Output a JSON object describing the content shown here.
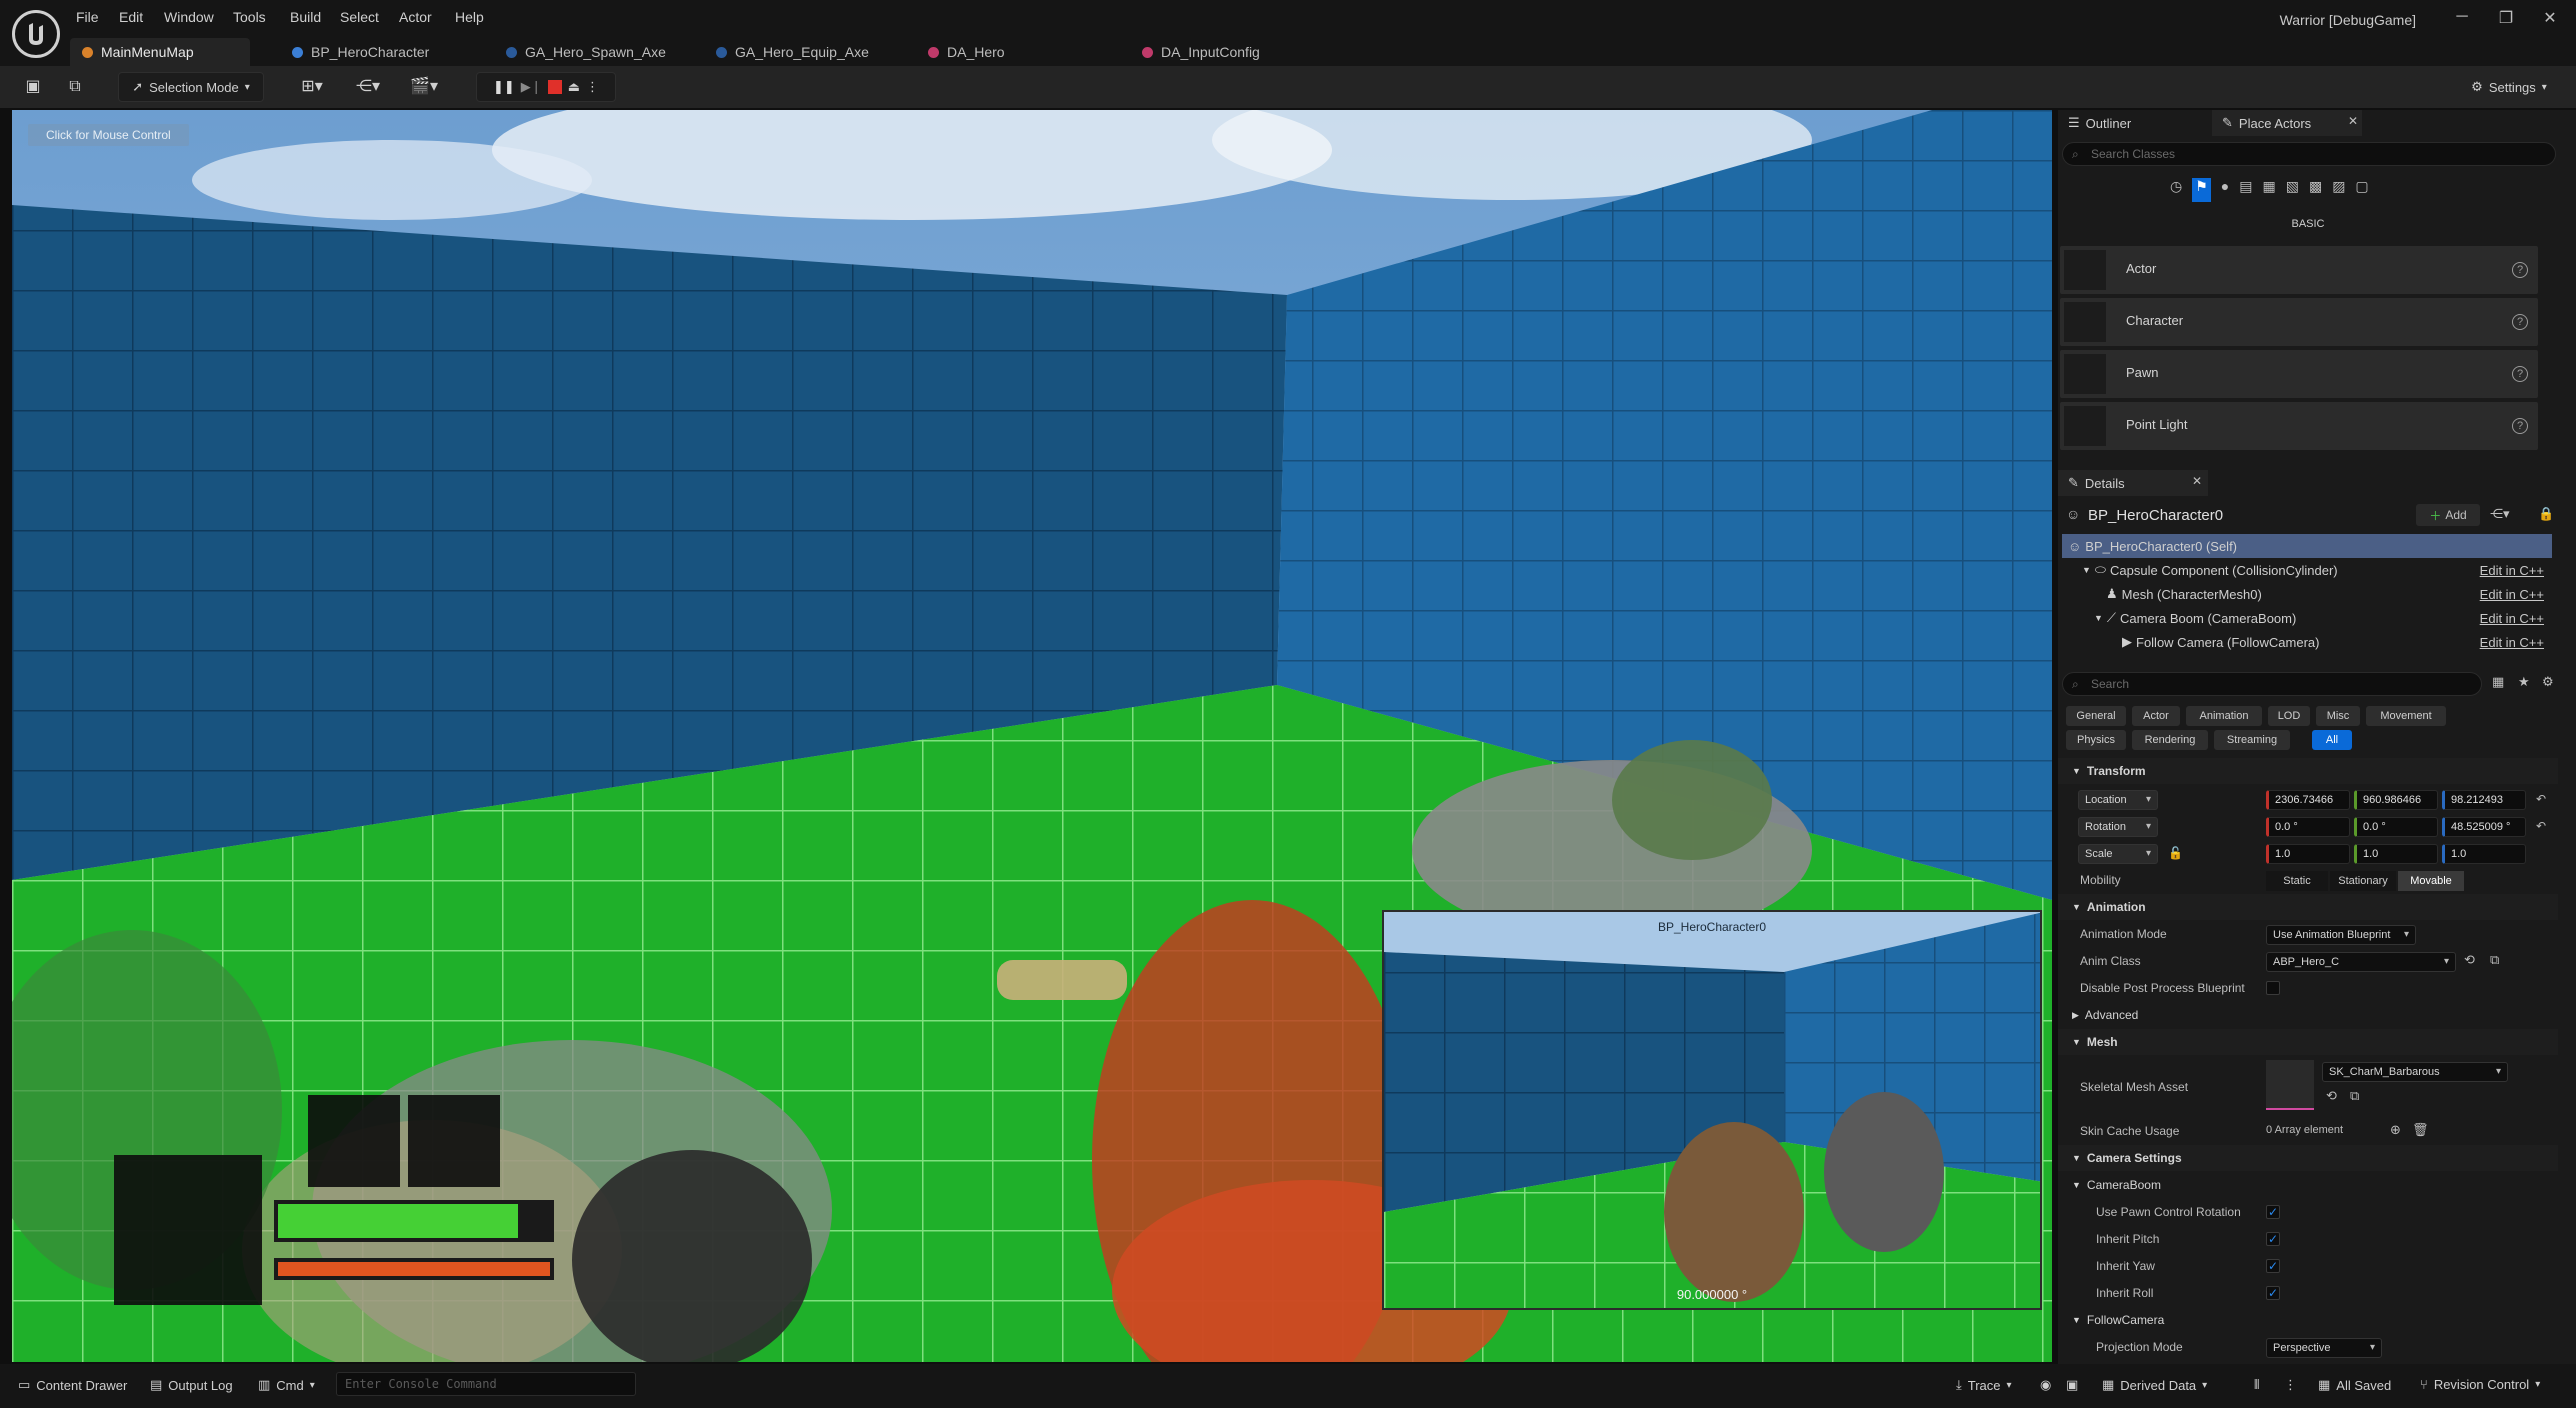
{
  "menu": {
    "items": [
      "File",
      "Edit",
      "Window",
      "Tools",
      "Build",
      "Select",
      "Actor",
      "Help"
    ]
  },
  "window": {
    "title": "Warrior [DebugGame]",
    "minimize": "─",
    "restore": "❐",
    "close": "✕"
  },
  "tabs": [
    {
      "label": "MainMenuMap",
      "color": "#d9822b"
    },
    {
      "label": "BP_HeroCharacter",
      "color": "#3b7fd6"
    },
    {
      "label": "GA_Hero_Spawn_Axe",
      "color": "#3b7fd6"
    },
    {
      "label": "GA_Hero_Equip_Axe",
      "color": "#3b7fd6"
    },
    {
      "label": "DA_Hero",
      "color": "#c03a6a"
    },
    {
      "label": "DA_InputConfig",
      "color": "#c03a6a"
    }
  ],
  "toolbar": {
    "selection_mode": "Selection Mode",
    "settings": "Settings"
  },
  "viewport": {
    "click_hint": "Click for Mouse Control",
    "pip_title": "BP_HeroCharacter0",
    "pip_fov": "90.000000 °"
  },
  "outliner": {
    "tab_outliner": "Outliner",
    "tab_place_actors": "Place Actors",
    "search_placeholder": "Search Classes",
    "category": "BASIC",
    "actors": [
      "Actor",
      "Character",
      "Pawn",
      "Point Light"
    ],
    "help": "?"
  },
  "details": {
    "tab_label": "Details",
    "object_name": "BP_HeroCharacter0",
    "add_label": "Add",
    "components": [
      {
        "label": "BP_HeroCharacter0 (Self)",
        "link": ""
      },
      {
        "label": "Capsule Component (CollisionCylinder)",
        "link": "Edit in C++"
      },
      {
        "label": "Mesh (CharacterMesh0)",
        "link": "Edit in C++"
      },
      {
        "label": "Camera Boom (CameraBoom)",
        "link": "Edit in C++"
      },
      {
        "label": "Follow Camera (FollowCamera)",
        "link": "Edit in C++"
      }
    ],
    "search_placeholder": "Search",
    "filters_row1": [
      "General",
      "Actor",
      "Animation",
      "LOD",
      "Misc",
      "Movement"
    ],
    "filters_row2": [
      "Physics",
      "Rendering",
      "Streaming",
      "All"
    ],
    "active_filter": "All",
    "transform": {
      "header": "Transform",
      "location_label": "Location",
      "location": [
        "2306.73466",
        "960.986466",
        "98.212493"
      ],
      "rotation_label": "Rotation",
      "rotation": [
        "0.0 °",
        "0.0 °",
        "48.525009 °"
      ],
      "scale_label": "Scale",
      "scale": [
        "1.0",
        "1.0",
        "1.0"
      ],
      "mobility_label": "Mobility",
      "mobility_options": [
        "Static",
        "Stationary",
        "Movable"
      ],
      "mobility_selected": "Movable"
    },
    "animation": {
      "header": "Animation",
      "mode_label": "Animation Mode",
      "mode_value": "Use Animation Blueprint",
      "class_label": "Anim Class",
      "class_value": "ABP_Hero_C",
      "disable_pp_label": "Disable Post Process Blueprint",
      "disable_pp": false
    },
    "advanced_label": "Advanced",
    "mesh": {
      "header": "Mesh",
      "asset_label": "Skeletal Mesh Asset",
      "asset_value": "SK_CharM_Barbarous",
      "skin_cache_label": "Skin Cache Usage",
      "skin_cache_value": "0 Array element"
    },
    "camera_settings": {
      "header": "Camera Settings",
      "boom_label": "CameraBoom",
      "checks": [
        {
          "label": "Use Pawn Control Rotation",
          "checked": true
        },
        {
          "label": "Inherit Pitch",
          "checked": true
        },
        {
          "label": "Inherit Yaw",
          "checked": true
        },
        {
          "label": "Inherit Roll",
          "checked": true
        }
      ],
      "follow_label": "FollowCamera",
      "projection_label": "Projection Mode",
      "projection_value": "Perspective"
    }
  },
  "statusbar": {
    "content_drawer": "Content Drawer",
    "output_log": "Output Log",
    "cmd": "Cmd",
    "console_placeholder": "Enter Console Command",
    "trace": "Trace",
    "derived_data": "Derived Data",
    "all_saved": "All Saved",
    "revision_control": "Revision Control"
  },
  "colors": {
    "accent": "#0a6ad8",
    "floor": "#22b02a",
    "walls": "#1a5a8c"
  }
}
